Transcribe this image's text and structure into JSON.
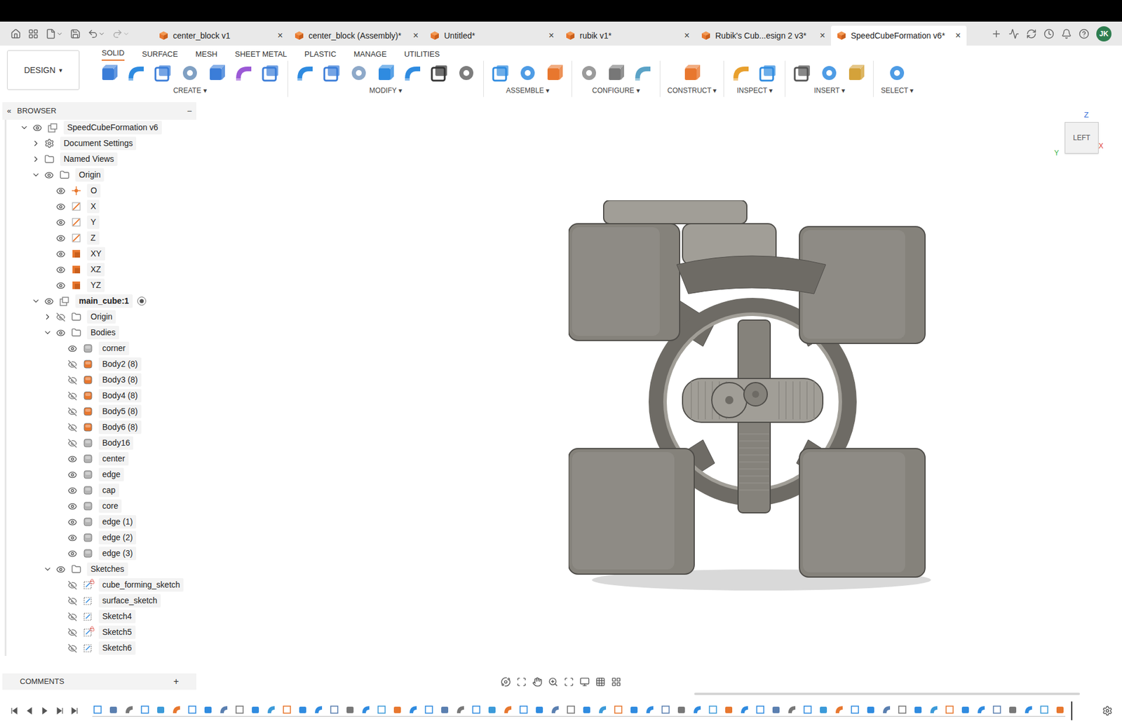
{
  "tabs": [
    {
      "label": "center_block v1",
      "selected": false
    },
    {
      "label": "center_block (Assembly)*",
      "selected": false
    },
    {
      "label": "Untitled*",
      "selected": false
    },
    {
      "label": "rubik v1*",
      "selected": false
    },
    {
      "label": "Rubik's Cub...esign 2 v3*",
      "selected": false
    },
    {
      "label": "SpeedCubeFormation v6*",
      "selected": true
    }
  ],
  "tab_close": "×",
  "user": "JK",
  "workspace": "DESIGN",
  "dropdown_glyph": "▾",
  "toolbar_tabs": [
    {
      "label": "SOLID",
      "selected": true
    },
    {
      "label": "SURFACE",
      "selected": false
    },
    {
      "label": "MESH",
      "selected": false
    },
    {
      "label": "SHEET METAL",
      "selected": false
    },
    {
      "label": "PLASTIC",
      "selected": false
    },
    {
      "label": "MANAGE",
      "selected": false
    },
    {
      "label": "UTILITIES",
      "selected": false
    }
  ],
  "toolbar_groups": [
    "CREATE",
    "MODIFY",
    "ASSEMBLE",
    "CONFIGURE",
    "CONSTRUCT",
    "INSPECT",
    "INSERT",
    "SELECT"
  ],
  "browser": {
    "title": "BROWSER",
    "pin": "«",
    "collapse": "–",
    "items": [
      {
        "label": "SpeedCubeFormation v6",
        "depth": 0,
        "kind": "document",
        "expandable": true,
        "expanded": true,
        "eye": true,
        "visible": true,
        "locked": false,
        "active": false,
        "color": "#8a8a8a"
      },
      {
        "label": "Document Settings",
        "depth": 1,
        "kind": "settings",
        "expandable": true,
        "expanded": false,
        "eye": false,
        "visible": true,
        "locked": false,
        "active": false,
        "color": "#8a8a8a"
      },
      {
        "label": "Named Views",
        "depth": 1,
        "kind": "folder",
        "expandable": true,
        "expanded": false,
        "eye": false,
        "visible": true,
        "locked": false,
        "active": false,
        "color": "#8a8a8a"
      },
      {
        "label": "Origin",
        "depth": 1,
        "kind": "folder",
        "expandable": true,
        "expanded": true,
        "eye": true,
        "visible": true,
        "locked": false,
        "active": false,
        "color": "#8a8a8a"
      },
      {
        "label": "O",
        "depth": 2,
        "kind": "point",
        "expandable": false,
        "expanded": false,
        "eye": true,
        "visible": true,
        "locked": false,
        "active": false,
        "color": "#e8772e"
      },
      {
        "label": "X",
        "depth": 2,
        "kind": "axis",
        "expandable": false,
        "expanded": false,
        "eye": true,
        "visible": true,
        "locked": false,
        "active": false,
        "color": "#e8772e"
      },
      {
        "label": "Y",
        "depth": 2,
        "kind": "axis",
        "expandable": false,
        "expanded": false,
        "eye": true,
        "visible": true,
        "locked": false,
        "active": false,
        "color": "#e8772e"
      },
      {
        "label": "Z",
        "depth": 2,
        "kind": "axis",
        "expandable": false,
        "expanded": false,
        "eye": true,
        "visible": true,
        "locked": false,
        "active": false,
        "color": "#e8772e"
      },
      {
        "label": "XY",
        "depth": 2,
        "kind": "plane",
        "expandable": false,
        "expanded": false,
        "eye": true,
        "visible": true,
        "locked": false,
        "active": false,
        "color": "#e8772e"
      },
      {
        "label": "XZ",
        "depth": 2,
        "kind": "plane",
        "expandable": false,
        "expanded": false,
        "eye": true,
        "visible": true,
        "locked": false,
        "active": false,
        "color": "#e8772e"
      },
      {
        "label": "YZ",
        "depth": 2,
        "kind": "plane",
        "expandable": false,
        "expanded": false,
        "eye": true,
        "visible": true,
        "locked": false,
        "active": false,
        "color": "#e8772e"
      },
      {
        "label": "main_cube:1",
        "depth": 1,
        "kind": "component",
        "expandable": true,
        "expanded": true,
        "eye": true,
        "visible": true,
        "locked": false,
        "active": true,
        "color": "#8a8a8a"
      },
      {
        "label": "Origin",
        "depth": 2,
        "kind": "folder",
        "expandable": true,
        "expanded": false,
        "eye": true,
        "visible": false,
        "locked": false,
        "active": false,
        "color": "#8a8a8a"
      },
      {
        "label": "Bodies",
        "depth": 2,
        "kind": "folder",
        "expandable": true,
        "expanded": true,
        "eye": true,
        "visible": true,
        "locked": false,
        "active": false,
        "color": "#8a8a8a"
      },
      {
        "label": "corner",
        "depth": 3,
        "kind": "body",
        "expandable": false,
        "expanded": false,
        "eye": true,
        "visible": true,
        "locked": false,
        "active": false,
        "color": "#b5b5b5"
      },
      {
        "label": "Body2 (8)",
        "depth": 3,
        "kind": "body",
        "expandable": false,
        "expanded": false,
        "eye": true,
        "visible": false,
        "locked": false,
        "active": false,
        "color": "#e8772e"
      },
      {
        "label": "Body3 (8)",
        "depth": 3,
        "kind": "body",
        "expandable": false,
        "expanded": false,
        "eye": true,
        "visible": false,
        "locked": false,
        "active": false,
        "color": "#e8772e"
      },
      {
        "label": "Body4 (8)",
        "depth": 3,
        "kind": "body",
        "expandable": false,
        "expanded": false,
        "eye": true,
        "visible": false,
        "locked": false,
        "active": false,
        "color": "#e8772e"
      },
      {
        "label": "Body5 (8)",
        "depth": 3,
        "kind": "body",
        "expandable": false,
        "expanded": false,
        "eye": true,
        "visible": false,
        "locked": false,
        "active": false,
        "color": "#e8772e"
      },
      {
        "label": "Body6 (8)",
        "depth": 3,
        "kind": "body",
        "expandable": false,
        "expanded": false,
        "eye": true,
        "visible": false,
        "locked": false,
        "active": false,
        "color": "#e8772e"
      },
      {
        "label": "Body16",
        "depth": 3,
        "kind": "body",
        "expandable": false,
        "expanded": false,
        "eye": true,
        "visible": false,
        "locked": false,
        "active": false,
        "color": "#b5b5b5"
      },
      {
        "label": "center",
        "depth": 3,
        "kind": "body",
        "expandable": false,
        "expanded": false,
        "eye": true,
        "visible": true,
        "locked": false,
        "active": false,
        "color": "#b5b5b5"
      },
      {
        "label": "edge",
        "depth": 3,
        "kind": "body",
        "expandable": false,
        "expanded": false,
        "eye": true,
        "visible": true,
        "locked": false,
        "active": false,
        "color": "#b5b5b5"
      },
      {
        "label": "cap",
        "depth": 3,
        "kind": "body",
        "expandable": false,
        "expanded": false,
        "eye": true,
        "visible": true,
        "locked": false,
        "active": false,
        "color": "#b5b5b5"
      },
      {
        "label": "core",
        "depth": 3,
        "kind": "body",
        "expandable": false,
        "expanded": false,
        "eye": true,
        "visible": true,
        "locked": false,
        "active": false,
        "color": "#b5b5b5"
      },
      {
        "label": "edge (1)",
        "depth": 3,
        "kind": "body",
        "expandable": false,
        "expanded": false,
        "eye": true,
        "visible": true,
        "locked": false,
        "active": false,
        "color": "#b5b5b5"
      },
      {
        "label": "edge (2)",
        "depth": 3,
        "kind": "body",
        "expandable": false,
        "expanded": false,
        "eye": true,
        "visible": true,
        "locked": false,
        "active": false,
        "color": "#b5b5b5"
      },
      {
        "label": "edge (3)",
        "depth": 3,
        "kind": "body",
        "expandable": false,
        "expanded": false,
        "eye": true,
        "visible": true,
        "locked": false,
        "active": false,
        "color": "#b5b5b5"
      },
      {
        "label": "Sketches",
        "depth": 2,
        "kind": "folder",
        "expandable": true,
        "expanded": true,
        "eye": true,
        "visible": true,
        "locked": false,
        "active": false,
        "color": "#8a8a8a"
      },
      {
        "label": "cube_forming_sketch",
        "depth": 3,
        "kind": "sketch",
        "expandable": false,
        "expanded": false,
        "eye": true,
        "visible": false,
        "locked": true,
        "active": false,
        "color": "#8a8a8a"
      },
      {
        "label": "surface_sketch",
        "depth": 3,
        "kind": "sketch",
        "expandable": false,
        "expanded": false,
        "eye": true,
        "visible": false,
        "locked": false,
        "active": false,
        "color": "#8a8a8a"
      },
      {
        "label": "Sketch4",
        "depth": 3,
        "kind": "sketch",
        "expandable": false,
        "expanded": false,
        "eye": true,
        "visible": false,
        "locked": false,
        "active": false,
        "color": "#8a8a8a"
      },
      {
        "label": "Sketch5",
        "depth": 3,
        "kind": "sketch",
        "expandable": false,
        "expanded": false,
        "eye": true,
        "visible": false,
        "locked": true,
        "active": false,
        "color": "#8a8a8a"
      },
      {
        "label": "Sketch6",
        "depth": 3,
        "kind": "sketch",
        "expandable": false,
        "expanded": false,
        "eye": true,
        "visible": false,
        "locked": false,
        "active": false,
        "color": "#8a8a8a"
      }
    ]
  },
  "comments": {
    "title": "COMMENTS",
    "add": "+"
  },
  "viewcube": {
    "face": "LEFT",
    "axes": [
      {
        "label": "Z",
        "color": "#3a6fd8"
      },
      {
        "label": "Y",
        "color": "#3bb54a"
      },
      {
        "label": "X",
        "color": "#e0403a"
      }
    ]
  }
}
